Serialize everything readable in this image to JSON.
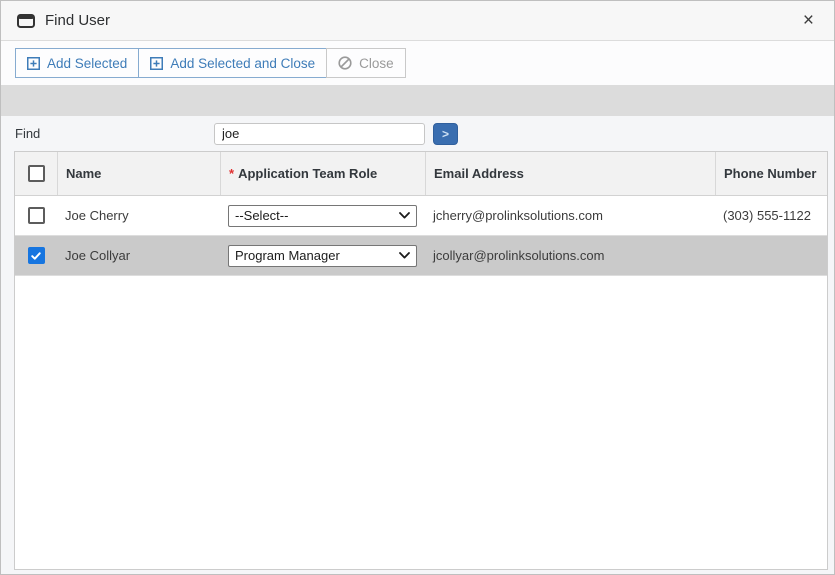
{
  "window": {
    "title": "Find User",
    "close_glyph": "×"
  },
  "toolbar": {
    "add_selected_label": "Add Selected",
    "add_selected_and_close_label": "Add Selected and Close",
    "close_label": "Close"
  },
  "search": {
    "label": "Find",
    "value": "joe",
    "go_glyph": ">"
  },
  "table": {
    "headers": {
      "name": "Name",
      "required_mark": "*",
      "role": "Application Team Role",
      "email": "Email Address",
      "phone": "Phone Number"
    },
    "rows": [
      {
        "checked": false,
        "selected": false,
        "name": "Joe Cherry",
        "role": "--Select--",
        "email": "jcherry@prolinksolutions.com",
        "phone": "(303) 555-1122"
      },
      {
        "checked": true,
        "selected": true,
        "name": "Joe Collyar",
        "role": "Program Manager",
        "email": "jcollyar@prolinksolutions.com",
        "phone": ""
      }
    ]
  },
  "colors": {
    "accent_blue_text": "#3e7cb8",
    "go_button_blue": "#3a6eb0",
    "checkbox_checked_blue": "#1675e0",
    "selected_row_gray": "#cacaca",
    "band_gray": "#dcdcdc",
    "titlebar_gray": "#f7f7f7"
  }
}
